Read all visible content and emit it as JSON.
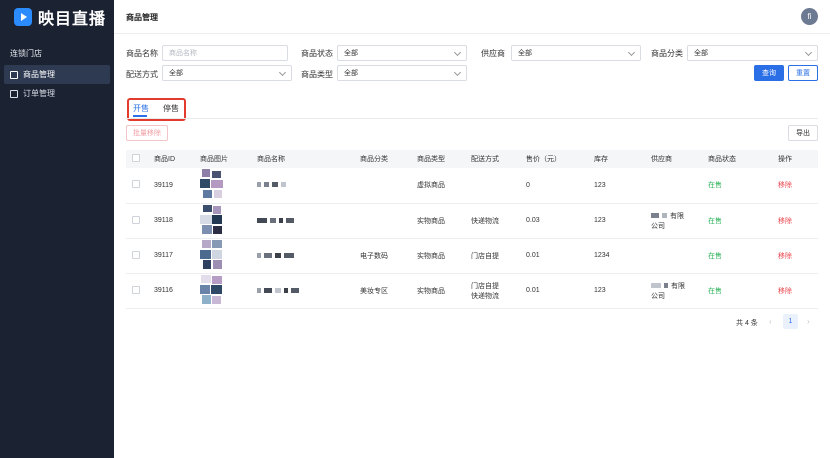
{
  "brand": {
    "name": "映目直播"
  },
  "sidebar": {
    "group": "连锁门店",
    "items": [
      {
        "label": "商品管理",
        "icon": "shopping-bag-icon",
        "active": true
      },
      {
        "label": "订单管理",
        "icon": "order-document-icon",
        "active": false
      }
    ]
  },
  "header": {
    "title": "商品管理",
    "avatar": "fi"
  },
  "filters": {
    "name_label": "商品名称",
    "name_placeholder": "商品名称",
    "status_label": "商品状态",
    "status_value": "全部",
    "supplier_label": "供应商",
    "supplier_value": "全部",
    "category_label": "商品分类",
    "category_value": "全部",
    "delivery_label": "配送方式",
    "delivery_value": "全部",
    "type_label": "商品类型",
    "type_value": "全部",
    "query_button": "查询",
    "reset_button": "重置"
  },
  "tabs": [
    {
      "label": "开售",
      "active": true
    },
    {
      "label": "停售",
      "active": false
    }
  ],
  "toolbar": {
    "batch_remove": "批量移除",
    "export": "导出"
  },
  "table": {
    "columns": [
      "商品ID",
      "商品图片",
      "商品名称",
      "商品分类",
      "商品类型",
      "配送方式",
      "售价（元）",
      "库存",
      "供应商",
      "商品状态",
      "操作"
    ],
    "rows": [
      {
        "id": "39119",
        "category": "",
        "type": "虚拟商品",
        "delivery": "",
        "delivery2": "",
        "price": "0",
        "stock": "123",
        "supplier_suffix": "",
        "supplier_line2": "",
        "status": "在售",
        "action": "移除"
      },
      {
        "id": "39118",
        "category": "",
        "type": "实物商品",
        "delivery": "快递物流",
        "delivery2": "",
        "price": "0.03",
        "stock": "123",
        "supplier_suffix": "有限",
        "supplier_line2": "公司",
        "status": "在售",
        "action": "移除"
      },
      {
        "id": "39117",
        "category": "电子数码",
        "type": "实物商品",
        "delivery": "门店自提",
        "delivery2": "",
        "price": "0.01",
        "stock": "1234",
        "supplier_suffix": "",
        "supplier_line2": "",
        "status": "在售",
        "action": "移除"
      },
      {
        "id": "39116",
        "category": "美妆专区",
        "type": "实物商品",
        "delivery": "门店自提",
        "delivery2": "快递物流",
        "price": "0.01",
        "stock": "123",
        "supplier_suffix": "有限",
        "supplier_line2": "公司",
        "status": "在售",
        "action": "移除"
      }
    ]
  },
  "pagination": {
    "total": "共 4 条",
    "current": "1",
    "prev": "‹",
    "next": "›"
  },
  "colors": {
    "primary": "#2b6fe6",
    "sidebar_bg": "#1b2232",
    "success": "#2cb35a",
    "danger": "#e8474e",
    "highlight_box": "#e23b2e"
  }
}
